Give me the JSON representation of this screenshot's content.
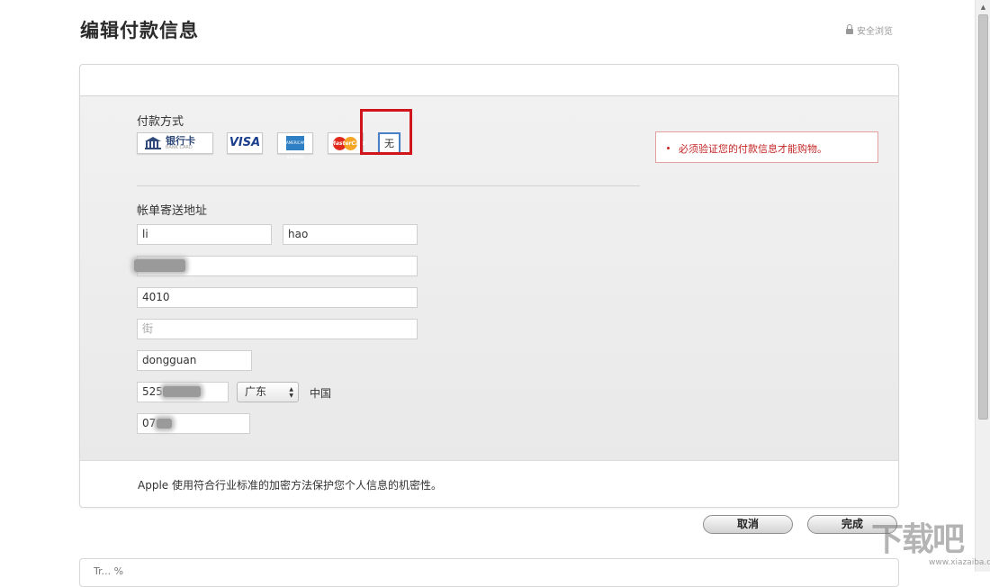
{
  "page": {
    "title": "编辑付款信息",
    "secure_label": "安全浏览"
  },
  "payment": {
    "section_label": "付款方式",
    "methods": {
      "bank_label": "银行卡",
      "bank_sub": "BANK CARD",
      "visa_label": "VISA",
      "amex_label": "AMERICAN EXPRESS",
      "mastercard_label": "MasterCard",
      "none_label": "无"
    },
    "selected": "无",
    "error_message": "必须验证您的付款信息才能购物。"
  },
  "billing": {
    "section_label": "帐单寄送地址",
    "first_name": "li",
    "last_name": "hao",
    "address_line1": "",
    "address_line2": "4010",
    "street_placeholder": "街",
    "city": "dongguan",
    "postal_code": "525",
    "province": "广东",
    "country": "中国",
    "phone": "07"
  },
  "footer": {
    "privacy_note": "Apple 使用符合行业标准的加密方法保护您个人信息的机密性。",
    "next_section_partial": "Tr... %"
  },
  "actions": {
    "cancel_label": "取消",
    "done_label": "完成"
  },
  "watermark": {
    "text": "下载吧",
    "url": "www.xiazaiba.com"
  },
  "colors": {
    "error": "#c42626",
    "highlight": "#d0161c",
    "selected_border": "#4a7fc8"
  }
}
